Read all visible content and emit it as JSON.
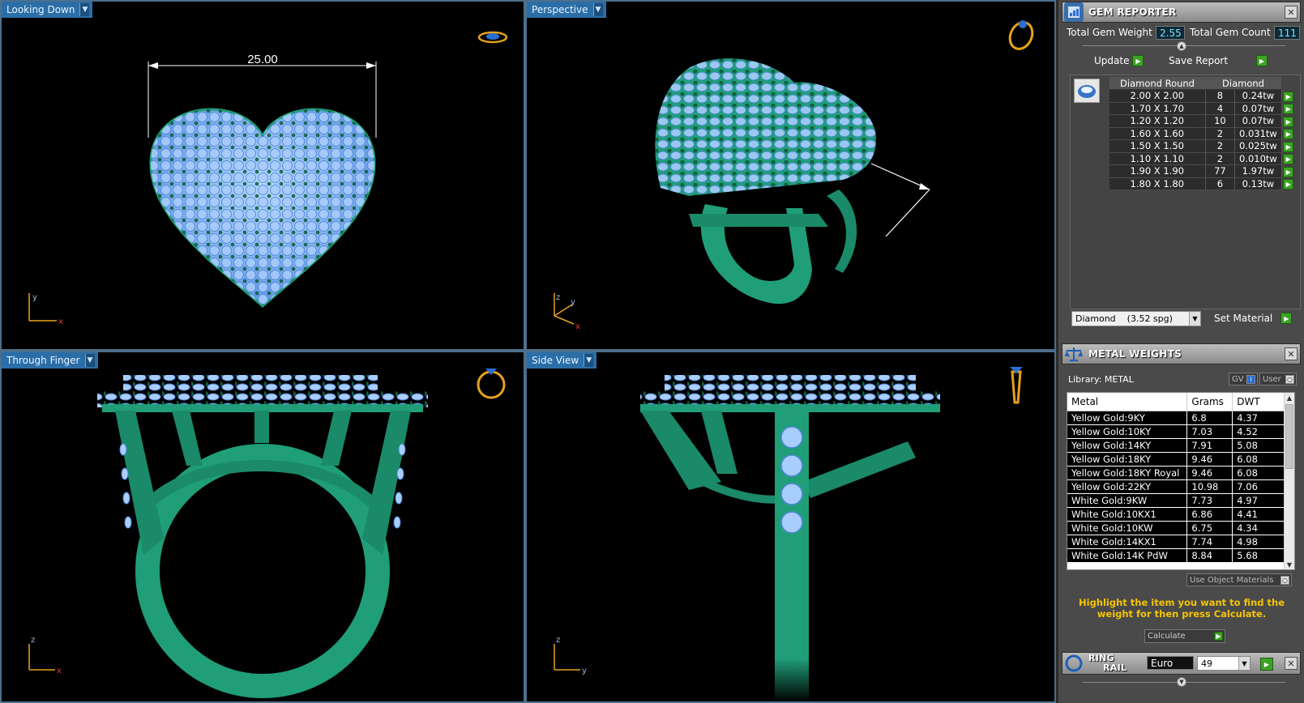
{
  "viewports": {
    "top": {
      "label": "Looking Down",
      "dimension": "25.00",
      "axes": {
        "h": "x",
        "v": "y"
      }
    },
    "perspective": {
      "label": "Perspective",
      "axes": {
        "a": "z",
        "b": "y",
        "c": "x"
      }
    },
    "front": {
      "label": "Through Finger",
      "axes": {
        "h": "x",
        "v": "z"
      }
    },
    "side": {
      "label": "Side View",
      "axes": {
        "h": "y",
        "v": "z"
      }
    }
  },
  "gem_reporter": {
    "title": "GEM REPORTER",
    "total_weight_label": "Total Gem Weight",
    "total_weight_value": "2.55",
    "total_count_label": "Total Gem Count",
    "total_count_value": "111",
    "update_label": "Update",
    "save_report_label": "Save Report",
    "table_headers": [
      "Diamond Round",
      "Diamond"
    ],
    "rows": [
      {
        "size": "2.00 X 2.00",
        "count": "8",
        "tw": "0.24tw"
      },
      {
        "size": "1.70 X 1.70",
        "count": "4",
        "tw": "0.07tw"
      },
      {
        "size": "1.20 X 1.20",
        "count": "10",
        "tw": "0.07tw"
      },
      {
        "size": "1.60 X 1.60",
        "count": "2",
        "tw": "0.031tw"
      },
      {
        "size": "1.50 X 1.50",
        "count": "2",
        "tw": "0.025tw"
      },
      {
        "size": "1.10 X 1.10",
        "count": "2",
        "tw": "0.010tw"
      },
      {
        "size": "1.90 X 1.90",
        "count": "77",
        "tw": "1.97tw"
      },
      {
        "size": "1.80 X 1.80",
        "count": "6",
        "tw": "0.13tw"
      }
    ],
    "material_select": "Diamond    (3.52 spg)",
    "set_material_label": "Set Material"
  },
  "metal_weights": {
    "title": "METAL WEIGHTS",
    "library_label": "Library: METAL",
    "gv_label": "GV",
    "user_label": "User",
    "headers": [
      "Metal",
      "Grams",
      "DWT"
    ],
    "rows": [
      {
        "metal": "Yellow Gold:9KY",
        "grams": "6.8",
        "dwt": "4.37"
      },
      {
        "metal": "Yellow Gold:10KY",
        "grams": "7.03",
        "dwt": "4.52"
      },
      {
        "metal": "Yellow Gold:14KY",
        "grams": "7.91",
        "dwt": "5.08"
      },
      {
        "metal": "Yellow Gold:18KY",
        "grams": "9.46",
        "dwt": "6.08"
      },
      {
        "metal": "Yellow Gold:18KY Royal",
        "grams": "9.46",
        "dwt": "6.08"
      },
      {
        "metal": "Yellow Gold:22KY",
        "grams": "10.98",
        "dwt": "7.06"
      },
      {
        "metal": "White Gold:9KW",
        "grams": "7.73",
        "dwt": "4.97"
      },
      {
        "metal": "White Gold:10KX1",
        "grams": "6.86",
        "dwt": "4.41"
      },
      {
        "metal": "White Gold:10KW",
        "grams": "6.75",
        "dwt": "4.34"
      },
      {
        "metal": "White Gold:14KX1",
        "grams": "7.74",
        "dwt": "4.98"
      },
      {
        "metal": "White Gold:14K PdW",
        "grams": "8.84",
        "dwt": "5.68"
      }
    ],
    "use_object_materials_label": "Use Object Materials",
    "hint": "Highlight the item you want to find the weight for then press Calculate.",
    "calculate_label": "Calculate"
  },
  "ring_rail": {
    "title_line1": "RING",
    "title_line2": "RAIL",
    "standard_value": "Euro",
    "size_value": "49"
  },
  "colors": {
    "metal_green": "#1f9e78",
    "gem_blue": "#9ec8ff",
    "prong_green": "#0f5a3c",
    "label_blue": "#2b6ea7",
    "hint_yellow": "#f5c400"
  }
}
